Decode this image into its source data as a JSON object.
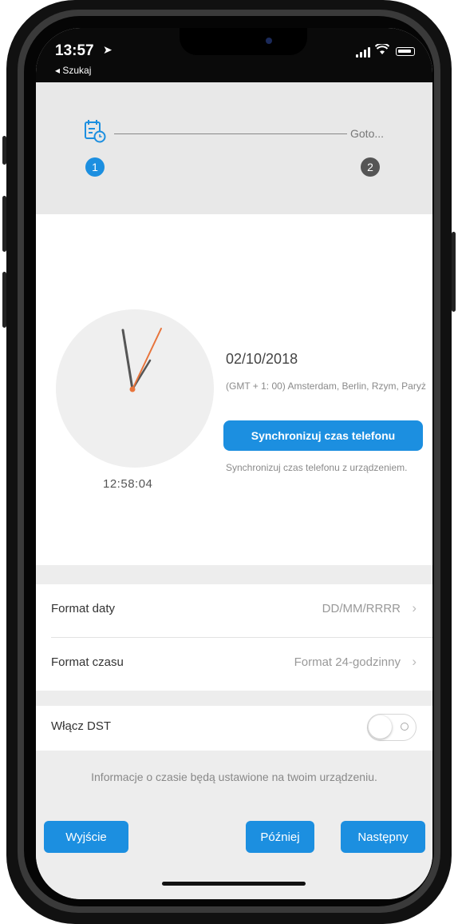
{
  "status_bar": {
    "time": "13:57",
    "location_arrow": "➤",
    "back_label": "◂ Szukaj"
  },
  "stepper": {
    "step1_number": "1",
    "step2_number": "2",
    "step2_label": "Goto..."
  },
  "clock": {
    "digital_time": "12:58:04"
  },
  "date_info": {
    "date": "02/10/2018",
    "timezone": "(GMT + 1: 00) Amsterdam, Berlin, Rzym, Paryż",
    "sync_button_label": "Synchronizuj czas telefonu",
    "sync_help": "Synchronizuj czas telefonu z urządzeniem."
  },
  "settings": {
    "date_format_label": "Format daty",
    "date_format_value": "DD/MM/RRRR",
    "time_format_label": "Format czasu",
    "time_format_value": "Format 24-godzinny",
    "chevron": "›"
  },
  "dst": {
    "label": "Włącz DST",
    "enabled": false
  },
  "footer": {
    "info": "Informacje o czasie będą ustawione na twoim urządzeniu.",
    "exit_label": "Wyjście",
    "later_label": "Później",
    "next_label": "Następny"
  },
  "colors": {
    "accent": "#1c8fe0",
    "hour_hand": "#555555",
    "minute_hand": "#e8743b",
    "inactive_step": "#555555"
  }
}
